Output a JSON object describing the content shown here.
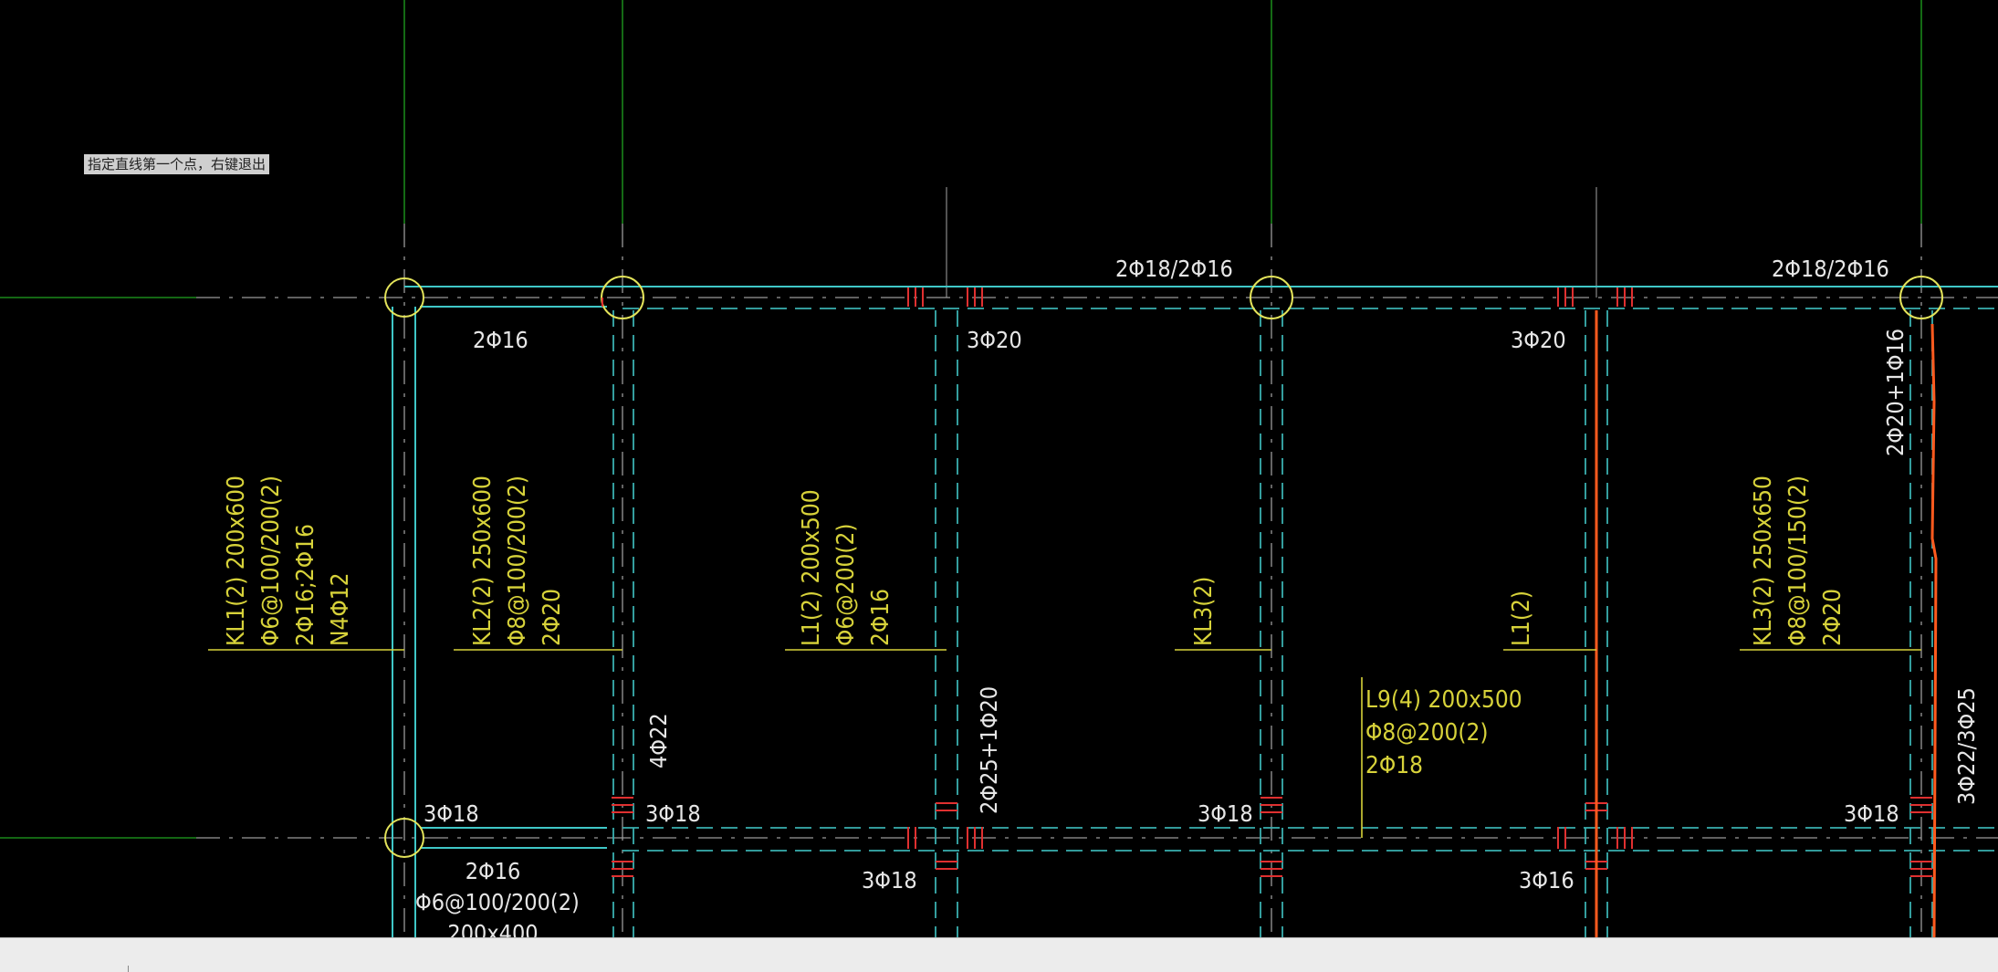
{
  "prompt": {
    "text": "指定直线第一个点，右键退出"
  },
  "colors": {
    "background": "#000000",
    "axis_green": "#1fa31f",
    "beam_cyan": "#3fc7c7",
    "dash_cyan": "#3ab0b0",
    "annotation_yellow": "#d7d23a",
    "rebar_white": "#e6e6e6",
    "rebar_red": "#e03030",
    "highlight_orange": "#ff5a1e",
    "statusbar": "#ececec"
  },
  "annotations": {
    "kl1": [
      "KL1(2) 200x600",
      "Φ6@100/200(2)",
      "2Φ16;2Φ16",
      "N4Φ12"
    ],
    "kl2": [
      "KL2(2) 250x600",
      "Φ8@100/200(2)",
      "2Φ20"
    ],
    "l1_left": [
      "L1(2) 200x500",
      "Φ6@200(2)",
      "2Φ16"
    ],
    "kl3_mid": [
      "KL3(2)"
    ],
    "l1_right": [
      "L1(2)"
    ],
    "kl3_right": [
      "KL3(2) 250x650",
      "Φ8@100/150(2)",
      "2Φ20"
    ],
    "l9": [
      "L9(4) 200x500",
      "Φ8@200(2)",
      "2Φ18"
    ],
    "bottom_left": [
      "2Φ16",
      "Φ6@100/200(2)",
      "200x400"
    ]
  },
  "rebar_labels": {
    "top_2phi18_a": "2Φ18/2Φ16",
    "top_2phi18_b": "2Φ18/2Φ16",
    "r_2phi16_top": "2Φ16",
    "r_3phi20_a": "3Φ20",
    "r_3phi20_b": "3Φ20",
    "r_3phi18_1": "3Φ18",
    "r_3phi18_2": "3Φ18",
    "r_3phi18_3": "3Φ18",
    "r_3phi18_4": "3Φ18",
    "r_3phi18_5": "3Φ18",
    "r_3phi16": "3Φ16",
    "v_4phi22": "4Φ22",
    "v_2phi25": "2Φ25+1Φ20",
    "v_2phi20": "2Φ20+1Φ16",
    "v_3phi22": "3Φ22/3Φ25"
  }
}
